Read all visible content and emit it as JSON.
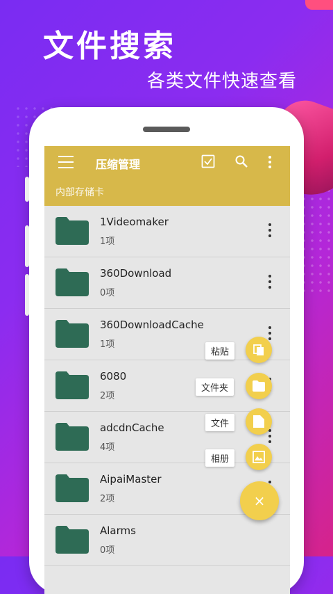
{
  "promo": {
    "headline": "文件搜索",
    "subline": "各类文件快速查看"
  },
  "appbar": {
    "title": "压缩管理",
    "path": "内部存储卡",
    "icons": [
      "menu-icon",
      "check-square-icon",
      "search-icon",
      "more-vert-icon"
    ],
    "color": "#d7b84a"
  },
  "files": [
    {
      "name": "1Videomaker",
      "count": "1项"
    },
    {
      "name": "360Download",
      "count": "0项"
    },
    {
      "name": "360DownloadCache",
      "count": "1项"
    },
    {
      "name": "6080",
      "count": "2项"
    },
    {
      "name": "adcdnCache",
      "count": "4项"
    },
    {
      "name": "AipaiMaster",
      "count": "2项"
    },
    {
      "name": "Alarms",
      "count": "0项"
    }
  ],
  "fab_menu": {
    "paste": "粘贴",
    "folder": "文件夹",
    "file": "文件",
    "album": "相册",
    "close_symbol": "×",
    "color": "#f2cf4d"
  },
  "colors": {
    "folder": "#2e6b55",
    "background_start": "#7a2cf2",
    "background_end": "#d6238a"
  }
}
